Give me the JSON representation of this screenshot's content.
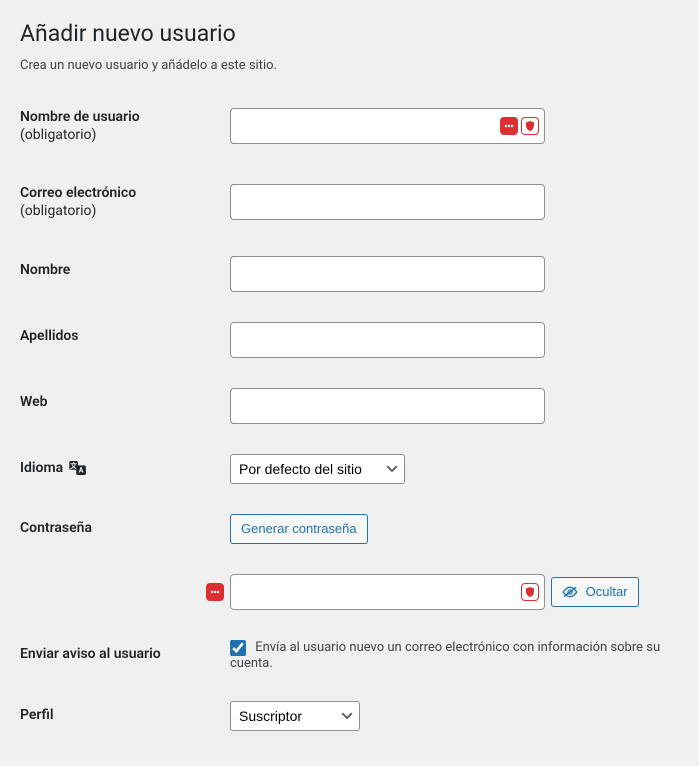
{
  "page": {
    "title": "Añadir nuevo usuario",
    "description": "Crea un nuevo usuario y añádelo a este sitio."
  },
  "fields": {
    "username": {
      "label": "Nombre de usuario",
      "required": "(obligatorio)",
      "value": ""
    },
    "email": {
      "label": "Correo electrónico",
      "required": "(obligatorio)",
      "value": ""
    },
    "firstname": {
      "label": "Nombre",
      "value": ""
    },
    "lastname": {
      "label": "Apellidos",
      "value": ""
    },
    "website": {
      "label": "Web",
      "value": ""
    },
    "language": {
      "label": "Idioma",
      "selected": "Por defecto del sitio"
    },
    "password": {
      "label": "Contraseña",
      "generate_button": "Generar contraseña",
      "value": "",
      "hide_button": "Ocultar"
    },
    "send_notice": {
      "label": "Enviar aviso al usuario",
      "checkbox_label": "Envía al usuario nuevo un correo electrónico con información sobre su cuenta.",
      "checked": true
    },
    "role": {
      "label": "Perfil",
      "selected": "Suscriptor"
    }
  }
}
